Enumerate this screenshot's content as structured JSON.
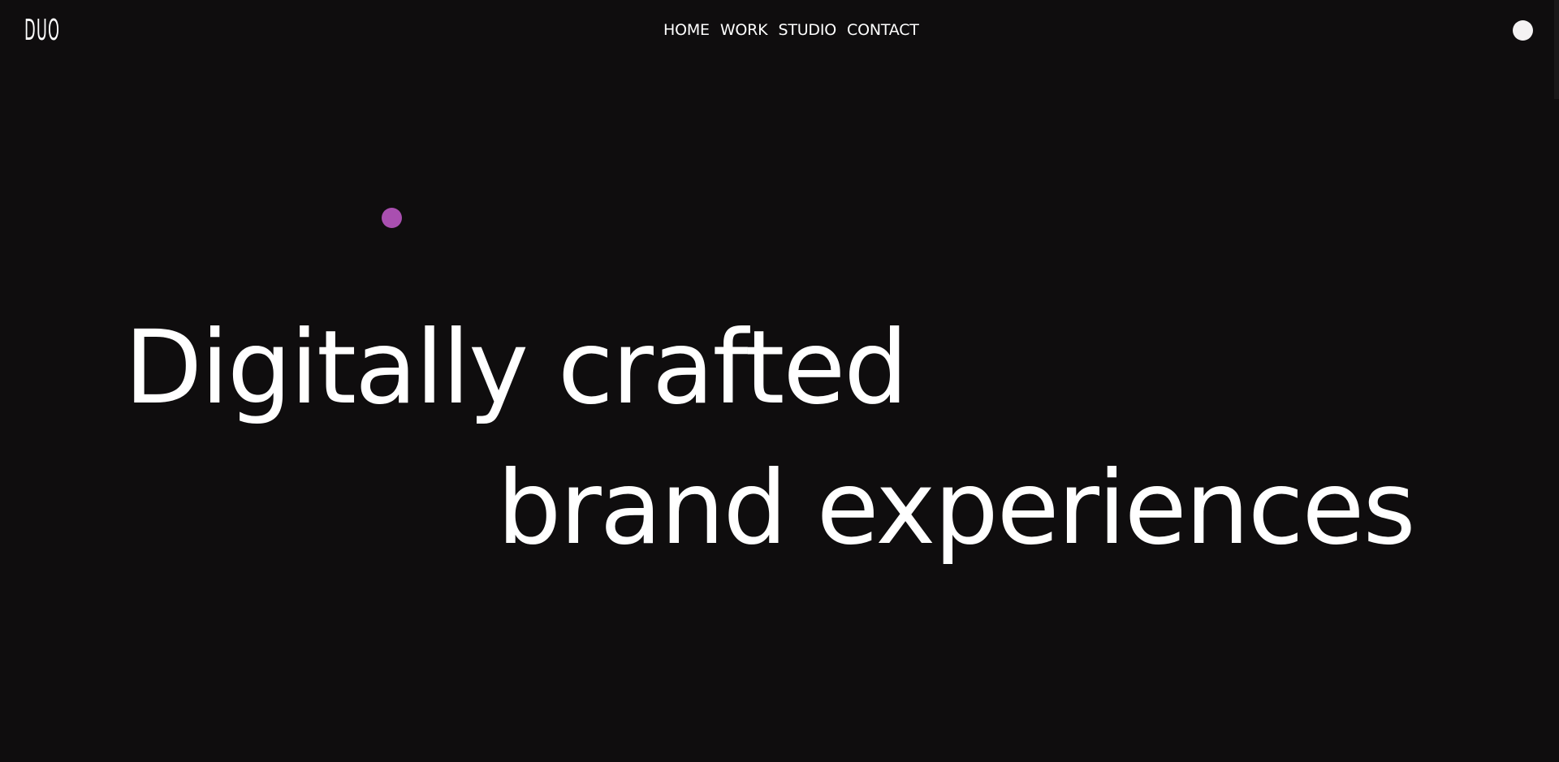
{
  "brand": {
    "logo_text": "DUO"
  },
  "nav": {
    "items": [
      {
        "label": "HOME"
      },
      {
        "label": "WORK"
      },
      {
        "label": "STUDIO"
      },
      {
        "label": "CONTACT"
      }
    ]
  },
  "hero": {
    "line1": "Digitally crafted",
    "line2": "brand experiences"
  },
  "colors": {
    "background": "#0f0d0e",
    "text": "#ffffff",
    "accent": "#a94fb0",
    "toggle": "#f4f2f3"
  },
  "icons": {
    "theme_toggle": "circle-toggle-icon",
    "accent": "dot-icon"
  }
}
